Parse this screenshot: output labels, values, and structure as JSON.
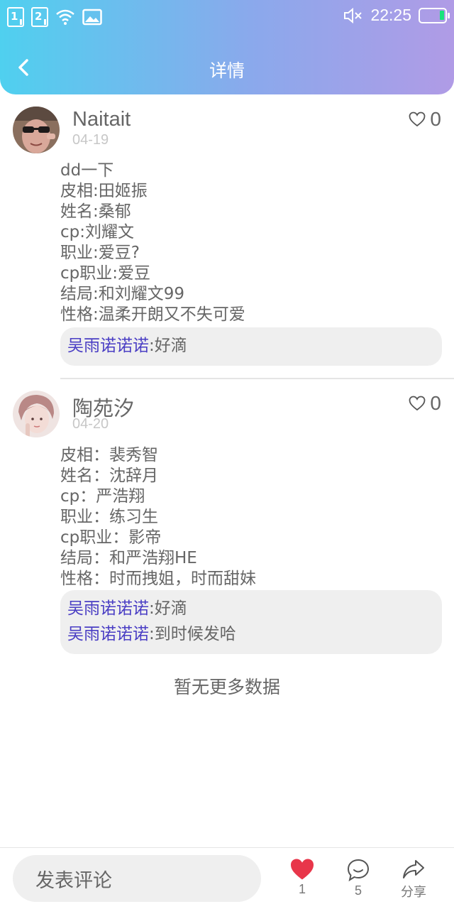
{
  "status_bar": {
    "sim1": "1",
    "sim2": "2",
    "time": "22:25"
  },
  "header": {
    "title": "详情"
  },
  "posts": [
    {
      "author": "Naitait",
      "date": "04-19",
      "likes": "0",
      "lines": [
        "dd一下",
        "皮相:田姬振",
        "姓名:桑郁",
        "cp:刘耀文",
        "职业:爱豆?",
        "cp职业:爱豆",
        "结局:和刘耀文99",
        "性格:温柔开朗又不失可爱"
      ],
      "comments": [
        {
          "user": "吴雨诺诺诺",
          "text": ":好滴"
        }
      ]
    },
    {
      "author": "陶苑汐",
      "date": "04-20",
      "likes": "0",
      "lines": [
        "皮相：裴秀智",
        "姓名：沈辞月",
        "cp：严浩翔",
        "职业：练习生",
        "cp职业：影帝",
        "结局：和严浩翔HE",
        "性格：时而拽姐，时而甜妹"
      ],
      "comments": [
        {
          "user": "吴雨诺诺诺",
          "text": ":好滴"
        },
        {
          "user": "吴雨诺诺诺",
          "text": ":到时候发哈"
        }
      ]
    }
  ],
  "footer_note": "暂无更多数据",
  "bottom_bar": {
    "comment_placeholder": "发表评论",
    "like_count": "1",
    "comment_count": "5",
    "share_label": "分享"
  },
  "colors": {
    "header_gradient": [
      "#4fd0ef",
      "#b09be6"
    ],
    "comment_user": "#4a3ec4",
    "like_active": "#e8364a",
    "battery": "#19e37b"
  }
}
